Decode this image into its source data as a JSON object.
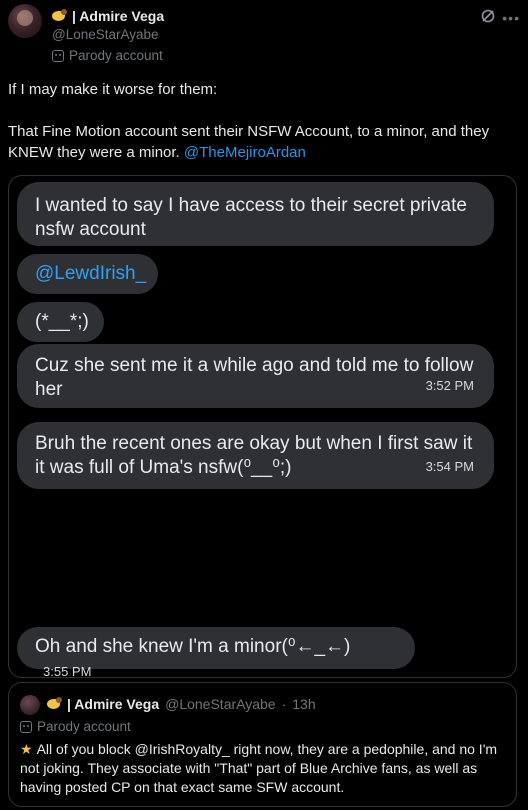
{
  "author": {
    "display_name": "| Admire Vega",
    "handle": "@LoneStarAyabe",
    "badge": "Parody account"
  },
  "tweet": {
    "paragraph1": "If I may make it worse for them:",
    "paragraph2": "That Fine Motion account sent their NSFW Account, to a minor, and they KNEW they were a minor.",
    "mention": "@TheMejiroArdan"
  },
  "screenshot_messages": [
    {
      "text": "I wanted to say I have access to their secret private nsfw account",
      "time": ""
    },
    {
      "text": "@LewdIrish_",
      "time": ""
    },
    {
      "text": "(*__*;)",
      "time": ""
    },
    {
      "text": "Cuz she sent me it a while ago and told me to follow her",
      "time": "3:52 PM"
    },
    {
      "text": "Bruh the recent ones are okay but when I first saw it it was full of Uma's nsfw(⁰__⁰;)",
      "time": "3:54 PM"
    },
    {
      "text": "Oh and she knew I'm a minor(⁰←_←)",
      "time": "3:55 PM"
    }
  ],
  "quote": {
    "display_name": "| Admire Vega",
    "handle": "@LoneStarAyabe",
    "age": "13h",
    "badge": "Parody account",
    "text": "All of you block @IrishRoyalty_ right now, they are a pedophile, and no I'm not joking. They associate with \"That\" part of Blue Archive fans, as well as having posted CP on that exact same SFW account."
  },
  "colors": {
    "background": "#000000",
    "link": "#1d9bf0",
    "muted": "#71767b",
    "bubble": "#2f3033"
  }
}
